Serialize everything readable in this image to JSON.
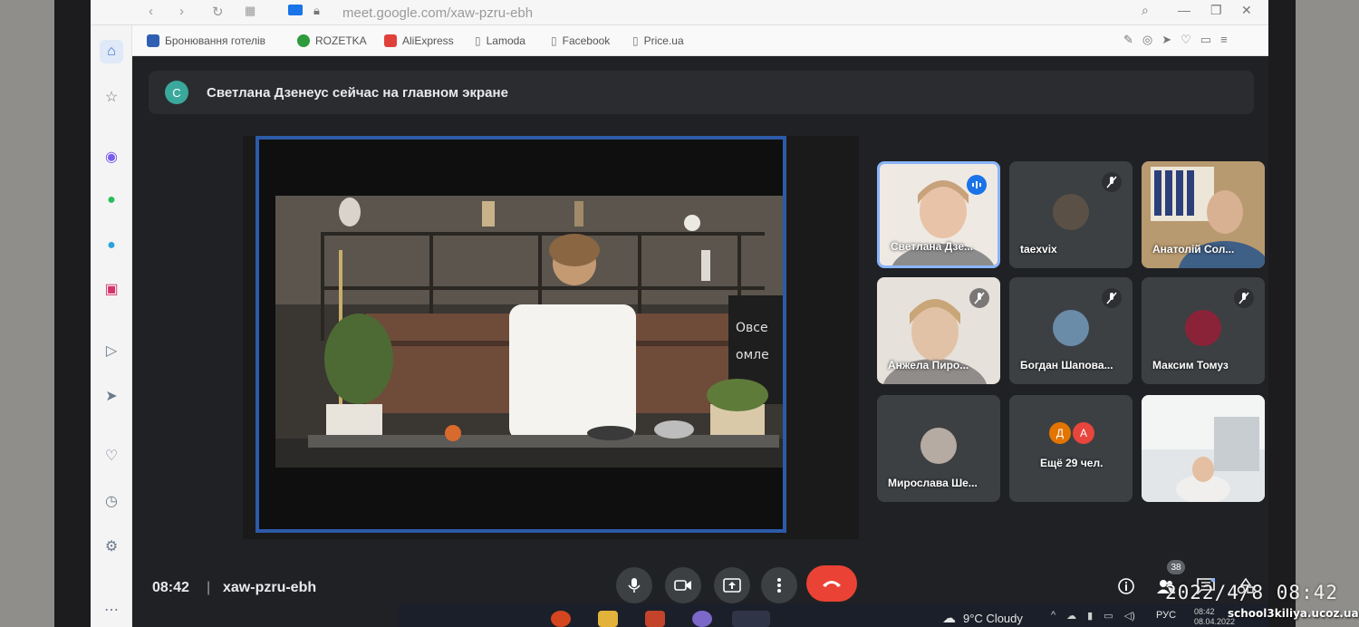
{
  "browser": {
    "url": "meet.google.com/xaw-pzru-ebh",
    "bookmarks": [
      {
        "label": "Бронювання готелів",
        "color": "#2f5fb3"
      },
      {
        "label": "ROZETKA",
        "color": "#2d9a3c"
      },
      {
        "label": "AliExpress",
        "color": "#e0403a"
      },
      {
        "label": "Lamoda",
        "color": "#7b7b7b"
      },
      {
        "label": "Facebook",
        "color": "#7b7b7b"
      },
      {
        "label": "Price.ua",
        "color": "#7b7b7b"
      }
    ]
  },
  "sidebar": {
    "icons": [
      "home-icon",
      "star-icon",
      "messenger-icon",
      "whatsapp-icon",
      "telegram-icon",
      "instagram-icon",
      "play-icon",
      "send-icon",
      "heart-icon",
      "history-icon",
      "settings-icon",
      "more-icon"
    ]
  },
  "banner": {
    "avatar_letter": "С",
    "text": "Светлана Дзенеус сейчас на главном экране"
  },
  "participants": [
    {
      "name": "Светлана Дзе...",
      "muted": false,
      "speaking": true
    },
    {
      "name": "taexvix",
      "muted": true
    },
    {
      "name": "Анатолій Сол...",
      "muted": false
    },
    {
      "name": "Анжела Пиро...",
      "muted": true
    },
    {
      "name": "Богдан Шапова...",
      "muted": true
    },
    {
      "name": "Максим Томуз",
      "muted": true
    },
    {
      "name": "Мирослава Ше...",
      "muted": false
    },
    {
      "name": "Ещё 29 чел.",
      "avatars": [
        "Д",
        "А"
      ],
      "avatar_colors": [
        "#e37400",
        "#e8453c"
      ]
    },
    {
      "name": "",
      "muted": false
    }
  ],
  "bottom": {
    "time": "08:42",
    "separator": "|",
    "meeting_code": "xaw-pzru-ebh",
    "people_count": "38"
  },
  "taskbar": {
    "weather": "9°C  Cloudy",
    "lang": "РУС",
    "date_line1": "08:42",
    "date_line2": "08.04.2022"
  },
  "overlay": {
    "timestamp": "2022/4/8  08:42",
    "watermark": "school3kiliya.ucoz.ua"
  },
  "colors": {
    "meet_bg": "#202124",
    "tile_bg": "#3c4043",
    "hangup": "#ea4335",
    "active_border": "#2c5ba8"
  }
}
